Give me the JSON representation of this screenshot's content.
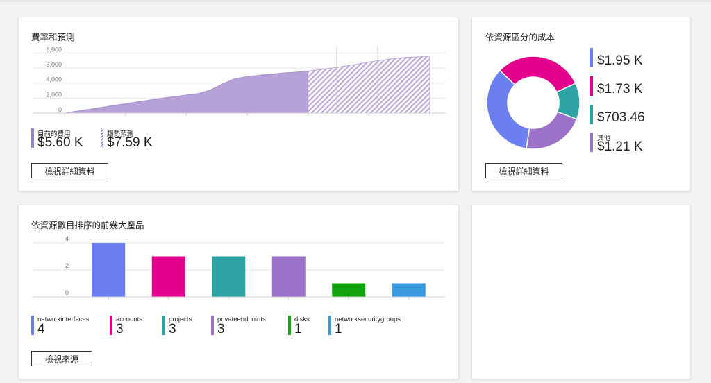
{
  "cards": {
    "rate": {
      "title": "費率和預測",
      "legend": [
        {
          "label": "目前的費用",
          "value": "$5.60 K",
          "color": "#9c83c7",
          "pattern": "solid"
        },
        {
          "label": "趨勢預測",
          "value": "$7.59 K",
          "color": "#9c83c7",
          "pattern": "hatched"
        }
      ],
      "button": "檢視詳細資料"
    },
    "cost": {
      "title": "依資源區分的成本",
      "legend": [
        {
          "label": "",
          "value": "$1.95 K",
          "color": "#6b7ff0"
        },
        {
          "label": "",
          "value": "$1.73 K",
          "color": "#e3008c"
        },
        {
          "label": "",
          "value": "$703.46",
          "color": "#2ea3a3"
        },
        {
          "label": "其他",
          "value": "$1.21 K",
          "color": "#9b72c8"
        }
      ],
      "button": "檢視詳細資料"
    },
    "products": {
      "title": "依資源數目排序的前幾大產品",
      "legend": [
        {
          "label": "networkinterfaces",
          "value": "4",
          "color": "#6b7ff0"
        },
        {
          "label": "accounts",
          "value": "3",
          "color": "#e3008c"
        },
        {
          "label": "projects",
          "value": "3",
          "color": "#2ea3a3"
        },
        {
          "label": "privateendpoints",
          "value": "3",
          "color": "#9b72c8"
        },
        {
          "label": "disks",
          "value": "1",
          "color": "#13a10e"
        },
        {
          "label": "networksecuritygroups",
          "value": "1",
          "color": "#3b99e0"
        }
      ],
      "button": "檢視來源"
    }
  },
  "chart_data": [
    {
      "type": "area",
      "title": "費率和預測",
      "yticks": [
        "8,000",
        "6,000",
        "4,000",
        "2,000",
        "0"
      ],
      "ylim": [
        0,
        8500
      ],
      "grid": true,
      "series": [
        {
          "name": "目前的費用",
          "x": [
            0,
            1,
            2,
            3,
            4,
            5,
            6,
            7,
            8,
            9,
            10,
            11,
            12,
            13,
            14,
            15,
            16,
            17,
            18,
            19,
            20
          ],
          "values": [
            0,
            250,
            500,
            750,
            1000,
            1250,
            1500,
            1750,
            2000,
            2200,
            2400,
            2600,
            3100,
            3900,
            4600,
            4850,
            5050,
            5200,
            5350,
            5450,
            5600
          ]
        },
        {
          "name": "趨勢預測",
          "x": [
            20,
            21,
            22,
            23,
            24,
            25,
            26,
            27,
            28,
            29,
            30
          ],
          "values": [
            5600,
            5800,
            6000,
            6250,
            6500,
            6800,
            7050,
            7250,
            7400,
            7500,
            7590
          ]
        }
      ]
    },
    {
      "type": "pie",
      "title": "依資源區分的成本",
      "series": [
        {
          "name": "",
          "value": 1950,
          "color": "#6b7ff0"
        },
        {
          "name": "",
          "value": 1730,
          "color": "#e3008c"
        },
        {
          "name": "",
          "value": 703.46,
          "color": "#2ea3a3"
        },
        {
          "name": "其他",
          "value": 1210,
          "color": "#9b72c8"
        }
      ]
    },
    {
      "type": "bar",
      "title": "依資源數目排序的前幾大產品",
      "categories": [
        "networkinterfaces",
        "accounts",
        "projects",
        "privateendpoints",
        "disks",
        "networksecuritygroups"
      ],
      "values": [
        4,
        3,
        3,
        3,
        1,
        1
      ],
      "colors": [
        "#6b7ff0",
        "#e3008c",
        "#2ea3a3",
        "#9b72c8",
        "#13a10e",
        "#3b99e0"
      ],
      "yticks": [
        "4",
        "2",
        "0"
      ],
      "ylim": [
        0,
        4
      ],
      "grid": true
    }
  ]
}
